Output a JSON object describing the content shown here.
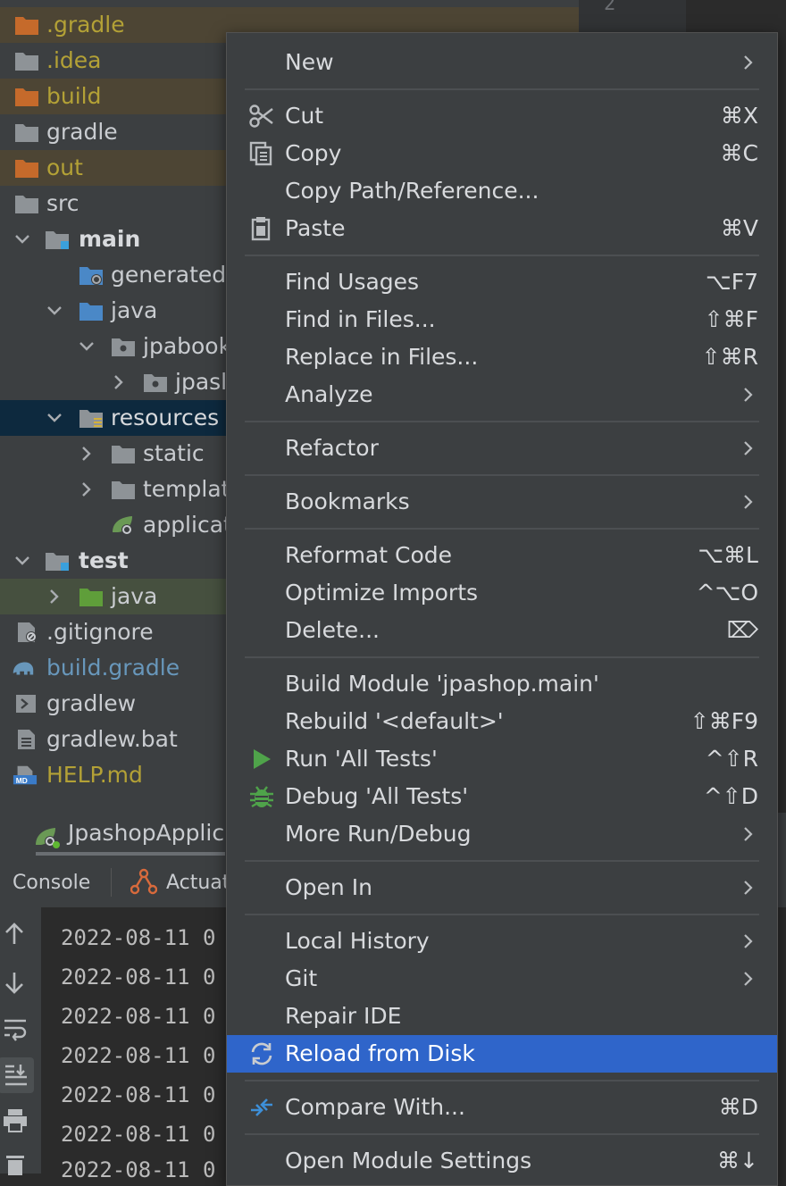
{
  "colors": {
    "tree_bg": "#3c3f41",
    "ignored_folder": "#c56a2b",
    "ignored_text": "#b3a136",
    "source_folder": "#4a88c7",
    "test_folder": "#5f9e3a",
    "menu_bg": "#3c3f41",
    "menu_selected": "#2f65ca"
  },
  "tree": {
    "items": [
      {
        "label": ".gradle"
      },
      {
        "label": ".idea"
      },
      {
        "label": "build"
      },
      {
        "label": "gradle"
      },
      {
        "label": "out"
      },
      {
        "label": "src"
      },
      {
        "label": "main"
      },
      {
        "label": "generated"
      },
      {
        "label": "java"
      },
      {
        "label": "jpabook"
      },
      {
        "label": "jpasl"
      },
      {
        "label": "resources"
      },
      {
        "label": "static"
      },
      {
        "label": "templat"
      },
      {
        "label": "applicat"
      },
      {
        "label": "test"
      },
      {
        "label": "java"
      },
      {
        "label": ".gitignore"
      },
      {
        "label": "build.gradle"
      },
      {
        "label": "gradlew"
      },
      {
        "label": "gradlew.bat"
      },
      {
        "label": "HELP.md"
      }
    ]
  },
  "editor": {
    "line_number": "2"
  },
  "run": {
    "config_tab": "JpashopApplic",
    "tabs": [
      {
        "label": "Console"
      },
      {
        "label": "Actuat"
      }
    ],
    "log_lines": [
      "2022-08-11 0",
      "2022-08-11 0",
      "2022-08-11 0",
      "2022-08-11 0",
      "2022-08-11 0",
      "2022-08-11 0",
      "2022-08-11 0"
    ]
  },
  "menu": {
    "items": [
      {
        "label": "New",
        "shortcut": "",
        "submenu": true
      },
      {
        "label": "Cut",
        "shortcut": "⌘X",
        "icon": "scissors-icon"
      },
      {
        "label": "Copy",
        "shortcut": "⌘C",
        "icon": "copy-icon"
      },
      {
        "label": "Copy Path/Reference...",
        "shortcut": ""
      },
      {
        "label": "Paste",
        "shortcut": "⌘V",
        "icon": "clipboard-icon"
      },
      {
        "label": "Find Usages",
        "shortcut": "⌥F7"
      },
      {
        "label": "Find in Files...",
        "shortcut": "⇧⌘F"
      },
      {
        "label": "Replace in Files...",
        "shortcut": "⇧⌘R"
      },
      {
        "label": "Analyze",
        "shortcut": "",
        "submenu": true
      },
      {
        "label": "Refactor",
        "shortcut": "",
        "submenu": true
      },
      {
        "label": "Bookmarks",
        "shortcut": "",
        "submenu": true
      },
      {
        "label": "Reformat Code",
        "shortcut": "⌥⌘L"
      },
      {
        "label": "Optimize Imports",
        "shortcut": "^⌥O"
      },
      {
        "label": "Delete...",
        "shortcut": "⌦"
      },
      {
        "label": "Build Module 'jpashop.main'",
        "shortcut": ""
      },
      {
        "label": "Rebuild '<default>'",
        "shortcut": "⇧⌘F9"
      },
      {
        "label": "Run 'All Tests'",
        "shortcut": "^⇧R",
        "icon": "run-triangle-icon"
      },
      {
        "label": "Debug 'All Tests'",
        "shortcut": "^⇧D",
        "icon": "debug-bug-icon"
      },
      {
        "label": "More Run/Debug",
        "shortcut": "",
        "submenu": true
      },
      {
        "label": "Open In",
        "shortcut": "",
        "submenu": true
      },
      {
        "label": "Local History",
        "shortcut": "",
        "submenu": true
      },
      {
        "label": "Git",
        "shortcut": "",
        "submenu": true
      },
      {
        "label": "Repair IDE",
        "shortcut": ""
      },
      {
        "label": "Reload from Disk",
        "shortcut": "",
        "icon": "reload-icon",
        "selected": true
      },
      {
        "label": "Compare With...",
        "shortcut": "⌘D",
        "icon": "compare-arrows-icon"
      },
      {
        "label": "Open Module Settings",
        "shortcut": "⌘↓"
      }
    ]
  }
}
